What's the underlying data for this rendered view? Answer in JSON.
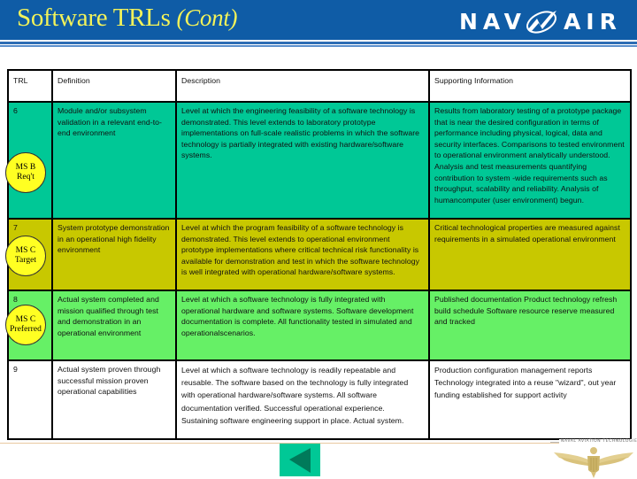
{
  "header": {
    "title_main": "Software TRLs",
    "title_suffix": "(Cont)",
    "logo_text_left": "NAV",
    "logo_text_right": "AIR",
    "logo_icon": "navair-swoosh-icon",
    "colors": {
      "bar": "#0F5CA6",
      "title": "#F2F25A",
      "logo": "#FFFFFF"
    }
  },
  "table": {
    "columns": [
      "TRL",
      "Definition",
      "Description",
      "Supporting Information"
    ],
    "rows": [
      {
        "trl": "6",
        "badge": {
          "line1": "MS B",
          "line2": "Req't"
        },
        "definition": "Module and/or subsystem validation in a relevant end-to-end environment",
        "description": "Level at which the engineering feasibility of a software technology is demonstrated. This level extends to laboratory prototype implementations on full-scale realistic problems in which the software technology is partially integrated with existing hardware/software systems.",
        "supporting": "Results from laboratory testing of a prototype package that is near the desired configuration in terms of performance including physical, logical, data and security interfaces. Comparisons to tested environment to operational environment analytically understood. Analysis and test measurements quantifying contribution to system -wide requirements such as throughput, scalability and reliability. Analysis of humancomputer (user environment) begun.",
        "color": "#00C896"
      },
      {
        "trl": "7",
        "badge": {
          "line1": "MS C",
          "line2": "Target"
        },
        "definition": "System prototype demonstration in an operational high fidelity environment",
        "description": "Level at which the program feasibility of a software technology is demonstrated. This level extends to operational environment prototype implementations where critical technical risk functionality is available for demonstration and test in which the software technology is well integrated with operational hardware/software systems.",
        "supporting": "Critical technological properties are measured against requirements in a simulated operational environment",
        "color": "#C8C800"
      },
      {
        "trl": "8",
        "badge": {
          "line1": "MS C",
          "line2": "Preferred"
        },
        "definition": "Actual system completed and mission qualified through test and demonstration in an operational environment",
        "description": "Level at which a software technology is fully integrated with operational hardware and software systems. Software development documentation is complete. All functionality tested in simulated and operationalscenarios.",
        "supporting": "Published documentation Product technology refresh build schedule Software resource reserve measured and tracked",
        "color": "#66F066"
      },
      {
        "trl": "9",
        "definition": "Actual system proven through successful mission proven operational capabilities",
        "description": "Level at which a software technology is readily repeatable and reusable. The software based on the technology is fully integrated with operational hardware/software systems. All software documentation verified. Successful operational experience. Sustaining software engineering support in place. Actual system.",
        "supporting": "Production configuration management reports Technology integrated into a reuse \"wizard\", out year funding established for support activity",
        "color": "#FFFFFF"
      }
    ]
  },
  "footer": {
    "prev_button_icon": "triangle-left-icon",
    "prev_button_color": "#00C896",
    "emblem_label": "NAVAL AVIATION TECHNOLOGIES",
    "emblem_icon": "naval-aviator-wings-icon"
  }
}
